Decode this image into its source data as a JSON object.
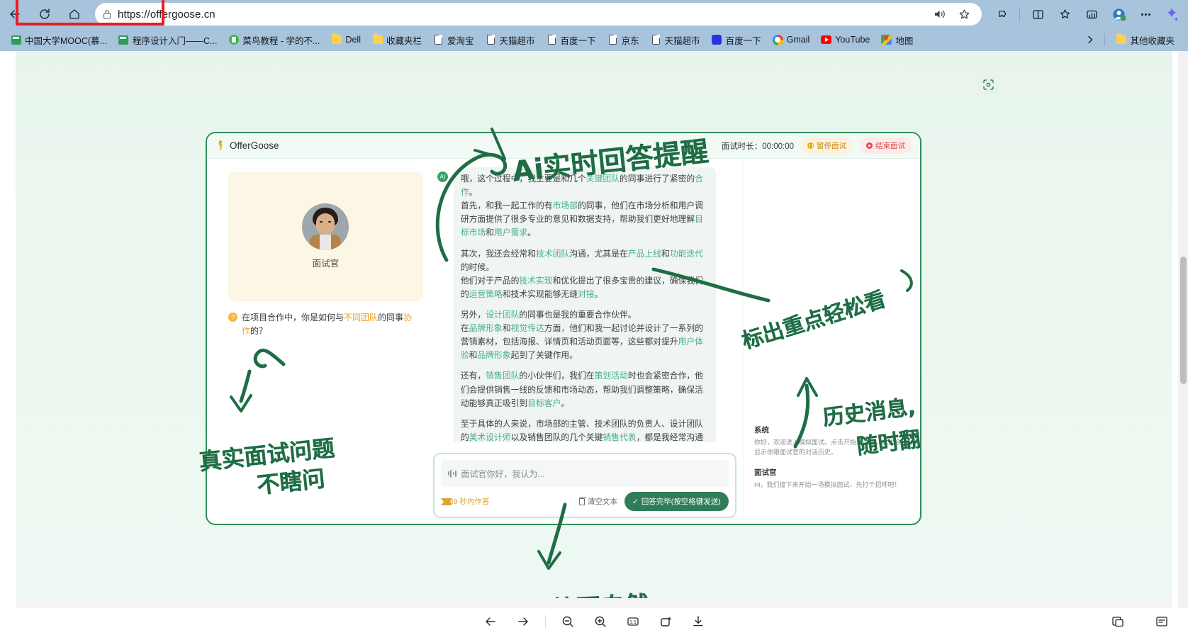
{
  "browser": {
    "url": "https://offergoose.cn",
    "nav": {
      "back_icon": "arrow-left-icon",
      "refresh_icon": "refresh-icon",
      "home_icon": "home-icon",
      "lock_icon": "lock-icon",
      "read_aloud_icon": "read-aloud-icon",
      "favorite_icon": "star-icon",
      "extensions_icon": "extensions-icon",
      "split_screen_icon": "split-screen-icon",
      "collections_icon": "collections-icon",
      "browser_essentials_icon": "browser-essentials-icon",
      "settings_icon": "more-options-icon",
      "copilot_icon": "copilot-icon"
    },
    "bookmarks": [
      {
        "label": "中国大学MOOC(慕...",
        "icon": "mooc-icon"
      },
      {
        "label": "程序设计入门——C...",
        "icon": "mooc-icon"
      },
      {
        "label": "菜鸟教程 - 学的不...",
        "icon": "runoob-icon"
      },
      {
        "label": "Dell",
        "icon": "folder-icon"
      },
      {
        "label": "收藏夹栏",
        "icon": "folder-icon"
      },
      {
        "label": "爱淘宝",
        "icon": "page-icon"
      },
      {
        "label": "天猫超市",
        "icon": "page-icon"
      },
      {
        "label": "百度一下",
        "icon": "page-icon"
      },
      {
        "label": "京东",
        "icon": "page-icon"
      },
      {
        "label": "天猫超市",
        "icon": "page-icon"
      },
      {
        "label": "百度一下",
        "icon": "baidu-icon"
      },
      {
        "label": "Gmail",
        "icon": "google-icon"
      },
      {
        "label": "YouTube",
        "icon": "youtube-icon"
      },
      {
        "label": "地图",
        "icon": "maps-icon"
      }
    ],
    "bookmark_overflow_icon": "chevron-right-icon",
    "other_bookmarks": {
      "label": "其他收藏夹",
      "icon": "folder-icon"
    }
  },
  "app": {
    "brand": "OfferGoose",
    "timer_label": "面试时长：00:00:00",
    "pause_button": "暂停面试",
    "end_button": "结束面试",
    "interviewer": {
      "name": "面试官",
      "question": "在项目合作中，你是如何与不同团队的同事协作的？",
      "question_pre": "在项目合作中，你是如何与",
      "question_hl1": "不同团队",
      "question_mid": "的同事",
      "question_hl2": "协作",
      "question_post": "的？"
    },
    "chat": {
      "ai_badge": "AI",
      "paragraphs": [
        "哦，这个过程中，我主要是和几个关键团队的同事进行了紧密的合作。\n首先，和我一起工作的有市场部的同事，他们在市场分析和用户调研方面提供了很多专业的意见和数据支持，帮助我们更好地理解目标市场和用户需求。",
        "其次，我还会经常和技术团队沟通，尤其是在产品上线和功能迭代的时候。\n他们对于产品的技术实现和优化提出了很多宝贵的建议，确保我们的运营策略和技术实现能够无缝对接。",
        "另外，设计团队的同事也是我的重要合作伙伴。\n在品牌形象和视觉传达方面，他们和我一起讨论并设计了一系列的营销素材，包括海报、详情页和活动页面等，这些都对提升用户体验和品牌形象起到了关键作用。",
        "还有，销售团队的小伙伴们，我们在策划活动时也会紧密合作，他们会提供销售一线的反馈和市场动态，帮助我们调整策略，确保活动能够真正吸引到目标客户。",
        "至于具体的人来说，市场部的主管、技术团队的负责人、设计团队的美术设计师以及销售团队的几个关键销售代表，都是我经常沟通的对象。"
      ]
    },
    "composer": {
      "placeholder": "面试官你好，我认为...",
      "mic_icon": "microphone-icon",
      "countdown": "69 秒内作答",
      "hourglass_icon": "hourglass-icon",
      "clear_button": "清空文本",
      "trash_icon": "trash-icon",
      "submit_button": "回答完毕(按空格键发送)",
      "check_icon": "check-icon"
    },
    "history": [
      {
        "name": "系统",
        "text": "你好，欢迎进入模拟面试。点击开始面试后，这里会显示你跟面试官的对话历史。"
      },
      {
        "name": "面试官",
        "text": "Hi，我们接下来开始一场模拟面试，先打个招呼吧！"
      }
    ]
  },
  "annotations": [
    {
      "id": "ann1",
      "text": "Ai实时回答提醒"
    },
    {
      "id": "ann2",
      "text": "标出重点轻松看"
    },
    {
      "id": "ann3",
      "text": "历史消息,"
    },
    {
      "id": "ann3b",
      "text": "随时翻"
    },
    {
      "id": "ann4",
      "text": "真实面试问题"
    },
    {
      "id": "ann4b",
      "text": "不瞎问"
    },
    {
      "id": "ann5",
      "text": "语音问答更自然"
    }
  ],
  "viewer_toolbar": {
    "prev_icon": "arrow-left-icon",
    "next_icon": "arrow-right-icon",
    "zoom_out_icon": "zoom-out-icon",
    "zoom_in_icon": "zoom-in-icon",
    "actual_size_icon": "actual-size-icon",
    "rotate_icon": "rotate-icon",
    "download_icon": "download-icon",
    "fit_page_icon": "fit-page-icon",
    "fit_width_icon": "fit-width-icon"
  },
  "page": {
    "lens_icon": "visual-search-icon"
  }
}
